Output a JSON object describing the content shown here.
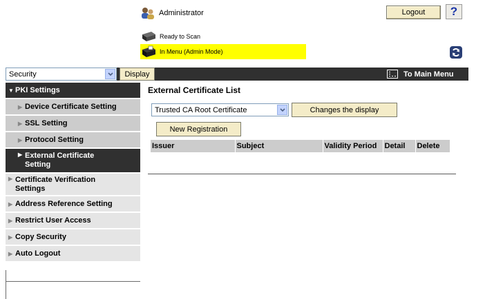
{
  "header": {
    "user_label": "Administrator",
    "logout_label": "Logout",
    "help_label": "?",
    "status_ready": "Ready to Scan",
    "status_menu": "In Menu (Admin Mode)",
    "status_menu_color": "#ffff00"
  },
  "topbar": {
    "category_value": "Security",
    "display_label": "Display",
    "main_menu_label": "To Main Menu",
    "bar_color": "#303030"
  },
  "sidebar": {
    "items": [
      {
        "label": "PKI Settings",
        "type": "section-open"
      },
      {
        "label": "Device Certificate Setting",
        "type": "sub"
      },
      {
        "label": "SSL Setting",
        "type": "sub"
      },
      {
        "label": "Protocol Setting",
        "type": "sub"
      },
      {
        "label": "External Certificate Setting",
        "type": "sub-active"
      },
      {
        "label": "Certificate Verification Settings",
        "type": "top"
      },
      {
        "label": "Address Reference Setting",
        "type": "top"
      },
      {
        "label": "Restrict User Access",
        "type": "top"
      },
      {
        "label": "Copy Security",
        "type": "top"
      },
      {
        "label": "Auto Logout",
        "type": "top"
      }
    ]
  },
  "main": {
    "title": "External Certificate List",
    "cert_type_value": "Trusted CA Root Certificate",
    "change_display_label": "Changes the display",
    "new_registration_label": "New Registration",
    "table_headers": [
      "Issuer",
      "Subject",
      "Validity Period",
      "Detail",
      "Delete"
    ]
  },
  "icons": {
    "admin": "admin-users-icon",
    "printer": "printer-icon",
    "refresh": "refresh-icon",
    "main_menu": "main-menu-icon",
    "dropdown": "chevron-down-icon"
  }
}
